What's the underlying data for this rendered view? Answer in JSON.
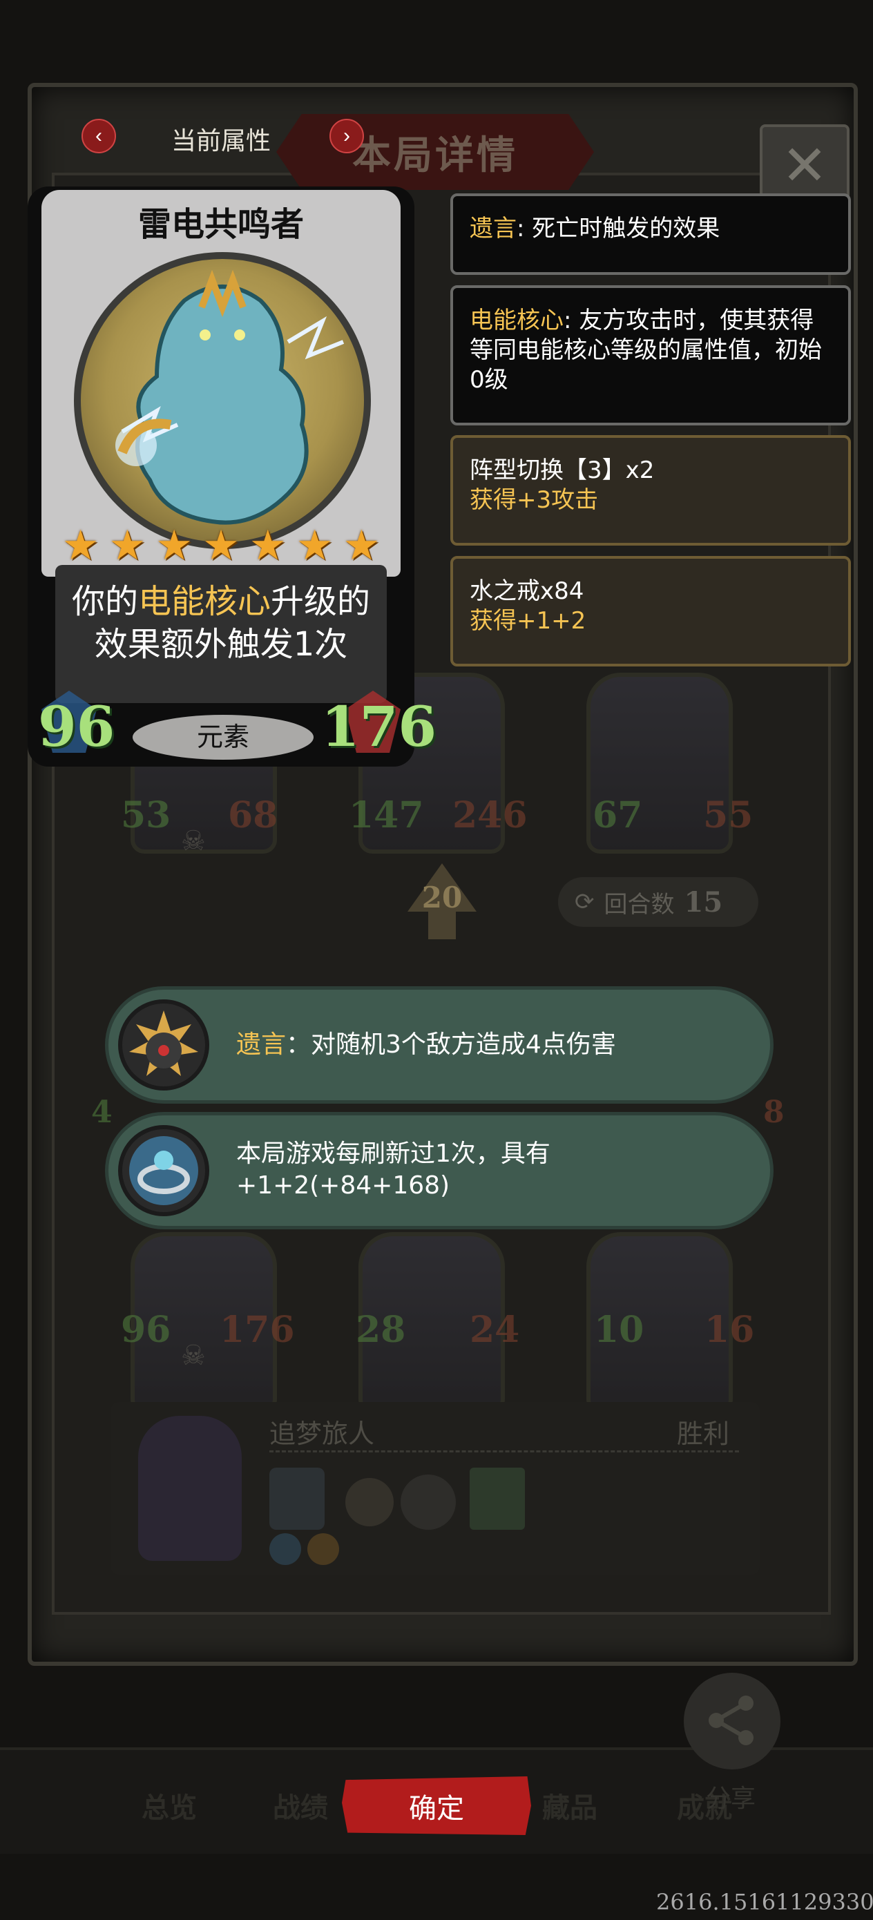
{
  "header": {
    "current_attributes": "当前属性",
    "tab_detail": "本局详情",
    "prev_icon": "chevron-left-icon",
    "next_icon": "chevron-right-icon",
    "close_icon": "close-icon"
  },
  "hero": {
    "name": "雷电共鸣者",
    "stars": 7,
    "desc_prefix": "你的",
    "desc_keyword": "电能核心",
    "desc_suffix": "升级的效果额外触发1次",
    "attack": "96",
    "health": "176",
    "tribe": "元素"
  },
  "info_boxes": [
    {
      "keyword": "遗言",
      "text": ": 死亡时触发的效果"
    },
    {
      "keyword": "电能核心",
      "text": ": 友方攻击时，使其获得等同电能核心等级的属性值，初始0级"
    },
    {
      "line1": "阵型切换【3】x2",
      "line2": "获得+3攻击"
    },
    {
      "line1": "水之戒x84",
      "line2": "获得+1+2"
    }
  ],
  "board": {
    "top_row": [
      {
        "attack": "53",
        "health": "68"
      },
      {
        "attack": "147",
        "health": "246"
      },
      {
        "attack": "67",
        "health": "55"
      }
    ],
    "bottom_row": [
      {
        "attack": "96",
        "health": "176"
      },
      {
        "attack": "28",
        "health": "24"
      },
      {
        "attack": "10",
        "health": "16"
      }
    ],
    "round": "20",
    "turns_label": "回合数",
    "turns_value": "15",
    "side_left": "4",
    "side_right": "8"
  },
  "tooltips": [
    {
      "keyword": "遗言",
      "text": "：对随机3个敌方造成4点伤害",
      "icon": "bomb-icon"
    },
    {
      "line1": "本局游戏每刷新过1次，具有",
      "line2": "+1+2(+84+168)",
      "icon": "water-ring-icon"
    }
  ],
  "player": {
    "name": "追梦旅人",
    "result": "胜利"
  },
  "bottom_tabs": [
    "总览",
    "战绩",
    "藏品",
    "成就"
  ],
  "confirm": "确定",
  "share": "分享",
  "coords": "2616.15161129330",
  "colors": {
    "accent_gold": "#f6c453",
    "confirm_red": "#b21c1c",
    "stat_green": "#a8e07c",
    "bubble_green": "#3f5a4f"
  }
}
